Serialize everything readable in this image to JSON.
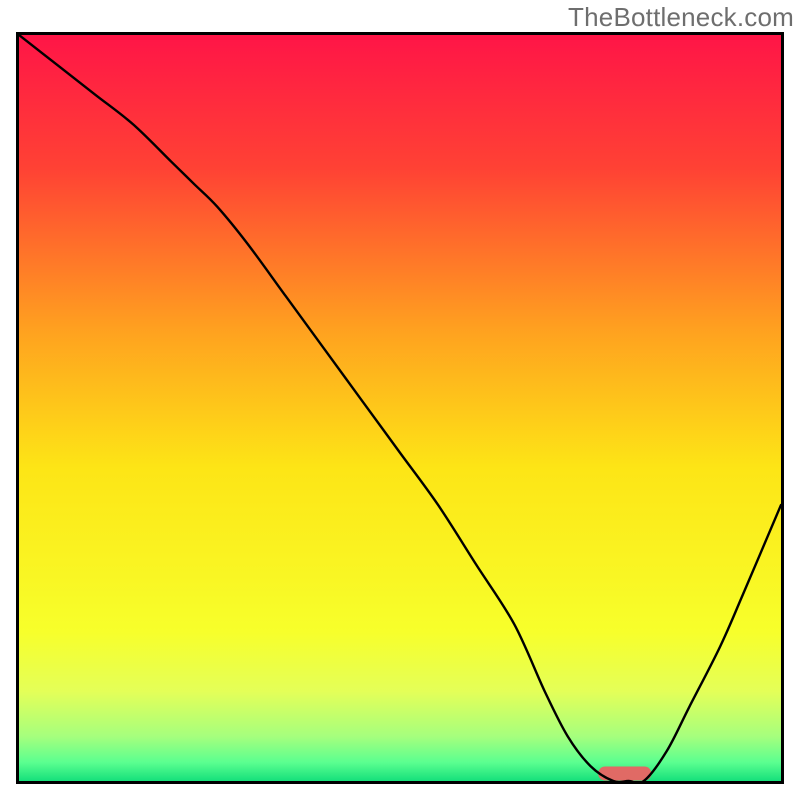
{
  "watermark": "TheBottleneck.com",
  "chart_data": {
    "type": "line",
    "title": "",
    "xlabel": "",
    "ylabel": "",
    "xlim": [
      0,
      100
    ],
    "ylim": [
      0,
      100
    ],
    "grid": false,
    "legend": false,
    "background_gradient": {
      "direction": "vertical",
      "stops": [
        {
          "offset": 0.0,
          "color": "#ff1547"
        },
        {
          "offset": 0.18,
          "color": "#ff4234"
        },
        {
          "offset": 0.4,
          "color": "#ffa31f"
        },
        {
          "offset": 0.58,
          "color": "#fde516"
        },
        {
          "offset": 0.8,
          "color": "#f7ff2b"
        },
        {
          "offset": 0.88,
          "color": "#e4ff58"
        },
        {
          "offset": 0.94,
          "color": "#a6ff7d"
        },
        {
          "offset": 0.975,
          "color": "#5bff90"
        },
        {
          "offset": 1.0,
          "color": "#15e07b"
        }
      ]
    },
    "series": [
      {
        "name": "bottleneck-curve",
        "color": "#000000",
        "type": "line",
        "x": [
          0,
          5,
          10,
          15,
          20,
          23,
          26,
          30,
          35,
          40,
          45,
          50,
          55,
          60,
          65,
          69,
          72,
          75,
          78,
          80,
          82,
          85,
          88,
          92,
          95,
          100
        ],
        "y": [
          100,
          96,
          92,
          88,
          83,
          80,
          77,
          72,
          65,
          58,
          51,
          44,
          37,
          29,
          21,
          12,
          6,
          2,
          0,
          0,
          0,
          4,
          10,
          18,
          25,
          37
        ]
      }
    ],
    "markers": [
      {
        "name": "optimal-range-marker",
        "type": "bar",
        "shape": "rounded",
        "x_start": 76,
        "x_end": 83,
        "y": 1,
        "color": "#e06a65"
      }
    ]
  }
}
